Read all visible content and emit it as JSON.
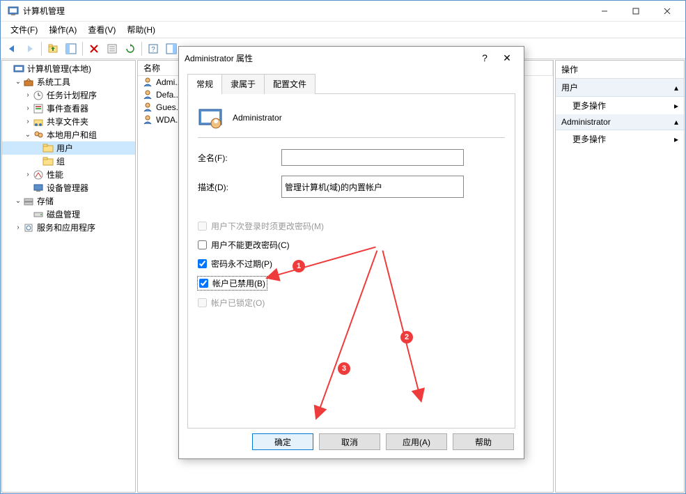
{
  "window": {
    "title": "计算机管理"
  },
  "menubar": {
    "file": "文件(F)",
    "action": "操作(A)",
    "view": "查看(V)",
    "help": "帮助(H)"
  },
  "tree": {
    "root": "计算机管理(本地)",
    "system_tools": "系统工具",
    "task_scheduler": "任务计划程序",
    "event_viewer": "事件查看器",
    "shared_folders": "共享文件夹",
    "local_users": "本地用户和组",
    "users": "用户",
    "groups": "组",
    "performance": "性能",
    "device_manager": "设备管理器",
    "storage": "存储",
    "disk_management": "磁盘管理",
    "services": "服务和应用程序"
  },
  "list": {
    "col_name": "名称",
    "items": {
      "admin": "Admi...",
      "default": "Defa...",
      "guest": "Gues...",
      "wda": "WDA..."
    }
  },
  "actions": {
    "header": "操作",
    "section1": "用户",
    "more1": "更多操作",
    "section2": "Administrator",
    "more2": "更多操作"
  },
  "dialog": {
    "title": "Administrator 属性",
    "tab_general": "常规",
    "tab_member": "隶属于",
    "tab_profile": "配置文件",
    "account_name": "Administrator",
    "fullname_label": "全名(F):",
    "fullname_value": "",
    "desc_label": "描述(D):",
    "desc_value": "管理计算机(域)的内置帐户",
    "chk_must_change": "用户下次登录时须更改密码(M)",
    "chk_cannot_change": "用户不能更改密码(C)",
    "chk_never_expire": "密码永不过期(P)",
    "chk_disabled": "帐户已禁用(B)",
    "chk_locked": "帐户已锁定(O)",
    "btn_ok": "确定",
    "btn_cancel": "取消",
    "btn_apply": "应用(A)",
    "btn_help": "帮助"
  },
  "annotations": {
    "a1": "1",
    "a2": "2",
    "a3": "3"
  }
}
